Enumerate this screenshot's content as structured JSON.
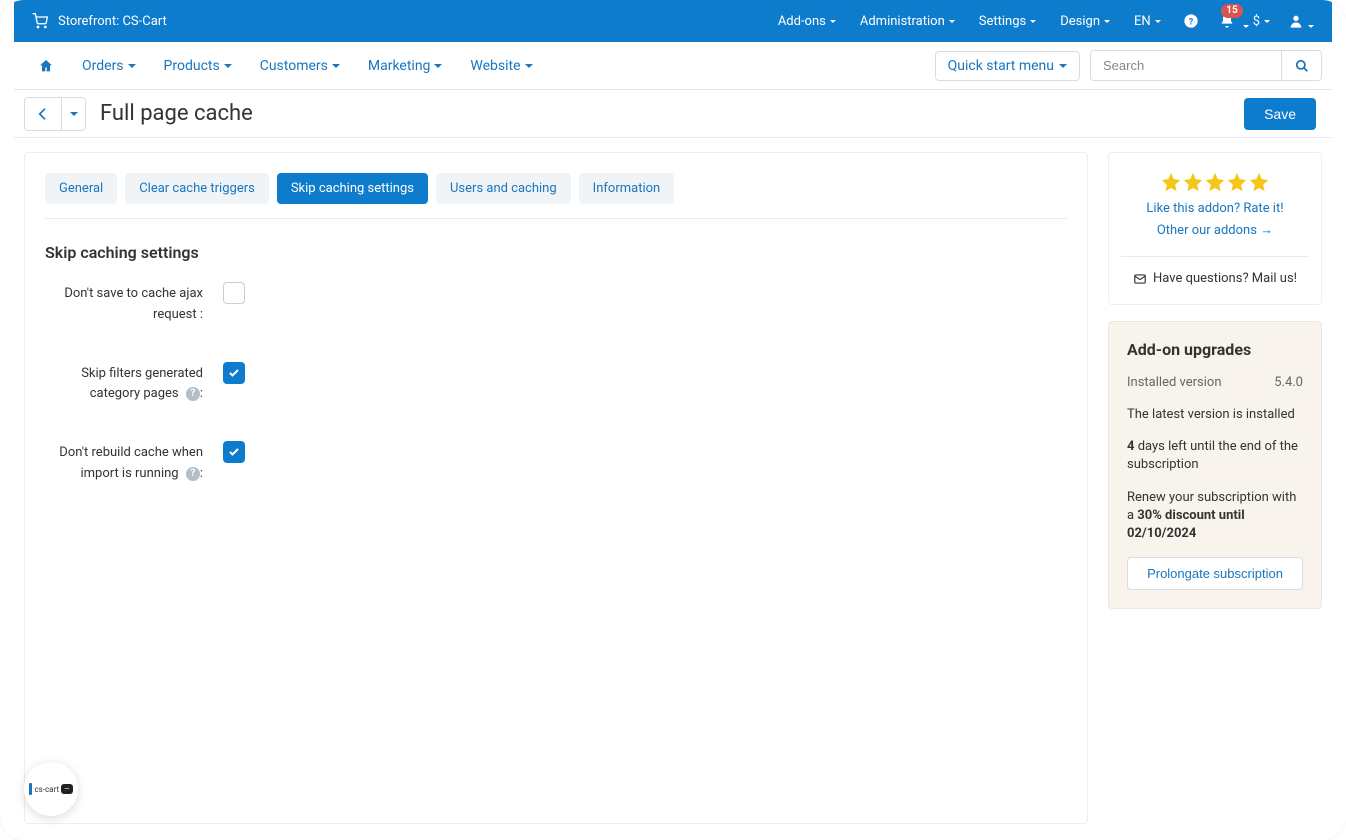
{
  "topbar": {
    "storefront_label": "Storefront: CS-Cart",
    "menu": [
      "Add-ons",
      "Administration",
      "Settings",
      "Design",
      "EN"
    ],
    "notification_count": "15",
    "currency": "$"
  },
  "subnav": {
    "items": [
      "Orders",
      "Products",
      "Customers",
      "Marketing",
      "Website"
    ],
    "quick_start": "Quick start menu",
    "search_placeholder": "Search"
  },
  "page": {
    "title": "Full page cache",
    "save_label": "Save"
  },
  "tabs": [
    {
      "label": "General",
      "active": false
    },
    {
      "label": "Clear cache triggers",
      "active": false
    },
    {
      "label": "Skip caching settings",
      "active": true
    },
    {
      "label": "Users and caching",
      "active": false
    },
    {
      "label": "Information",
      "active": false
    }
  ],
  "section": {
    "heading": "Skip caching settings",
    "fields": [
      {
        "label": "Don't save to cache ajax request :",
        "checked": false,
        "help": false
      },
      {
        "label": "Skip filters generated category pages",
        "checked": true,
        "help": true
      },
      {
        "label": "Don't rebuild cache when import is running",
        "checked": true,
        "help": true
      }
    ]
  },
  "rating_box": {
    "rate_link": "Like this addon? Rate it!",
    "other_link": "Other our addons →",
    "mail_text": "Have questions? Mail us!"
  },
  "upgrade": {
    "title": "Add-on upgrades",
    "installed_label": "Installed version",
    "installed_value": "5.4.0",
    "latest_text": "The latest version is installed",
    "days_bold": "4",
    "days_text": " days left until the end of the subscription",
    "renew_prefix": "Renew your subscription with a ",
    "renew_bold": "30% discount until 02/10/2024",
    "prolong_label": "Prolongate subscription"
  },
  "float_logo_text": "cs-cart"
}
